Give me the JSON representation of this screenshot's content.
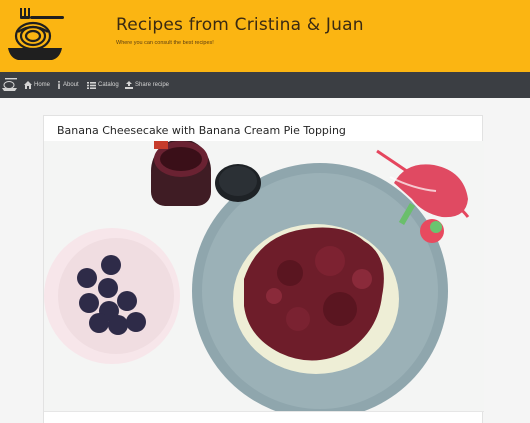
{
  "header": {
    "title": "Recipes from Cristina & Juan",
    "subtitle": "Where you can consult the best recipes!",
    "logo_icon": "spaghetti-plate-icon"
  },
  "nav": {
    "brand_icon": "spaghetti-plate-icon",
    "items": [
      {
        "label": "Home",
        "icon": "home-icon"
      },
      {
        "label": "About",
        "icon": "info-icon"
      },
      {
        "label": "Catalog",
        "icon": "list-icon"
      },
      {
        "label": "Share recipe",
        "icon": "upload-icon"
      }
    ]
  },
  "recipe": {
    "title": "Banana Cheesecake with Banana Cream Pie Topping"
  },
  "colors": {
    "header_bg": "#fbb512",
    "nav_bg": "#3b3e43",
    "nav_text": "#d4d4d4"
  }
}
